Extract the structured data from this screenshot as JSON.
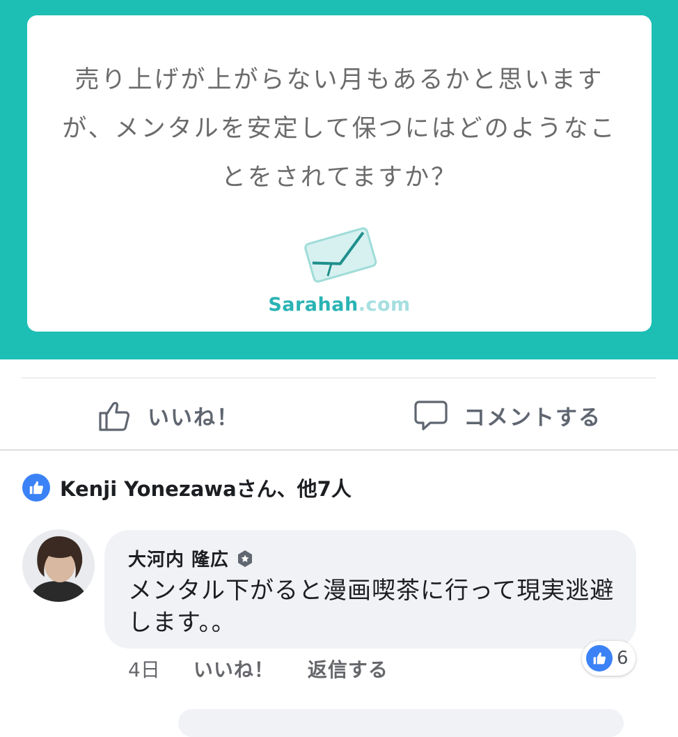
{
  "post": {
    "question_text": "売り上げが上がらない月もあるかと思いますが、メンタルを安定して保つにはどのようなことをされてますか？",
    "brand_main": "Sarahah",
    "brand_suffix": ".com",
    "panel_color": "#1dbfb5"
  },
  "actions": {
    "like_label": "いいね！",
    "like_icon": "thumbs-up-outline-icon",
    "comment_label": "コメントする",
    "comment_icon": "speech-bubble-icon"
  },
  "likes_summary": {
    "text": "Kenji Yonezawaさん、他7人",
    "icon": "like-badge-icon"
  },
  "comment": {
    "author": "大河内 隆広",
    "author_badge_icon": "verified-star-icon",
    "text": "メンタル下がると漫画喫茶に行って現実逃避します。。",
    "reaction_count": "6",
    "time": "4日",
    "like_label": "いいね！",
    "reply_label": "返信する"
  },
  "colors": {
    "accent_blue": "#3b82f6",
    "text_dark": "#1c1e21",
    "text_muted": "#65676b"
  }
}
